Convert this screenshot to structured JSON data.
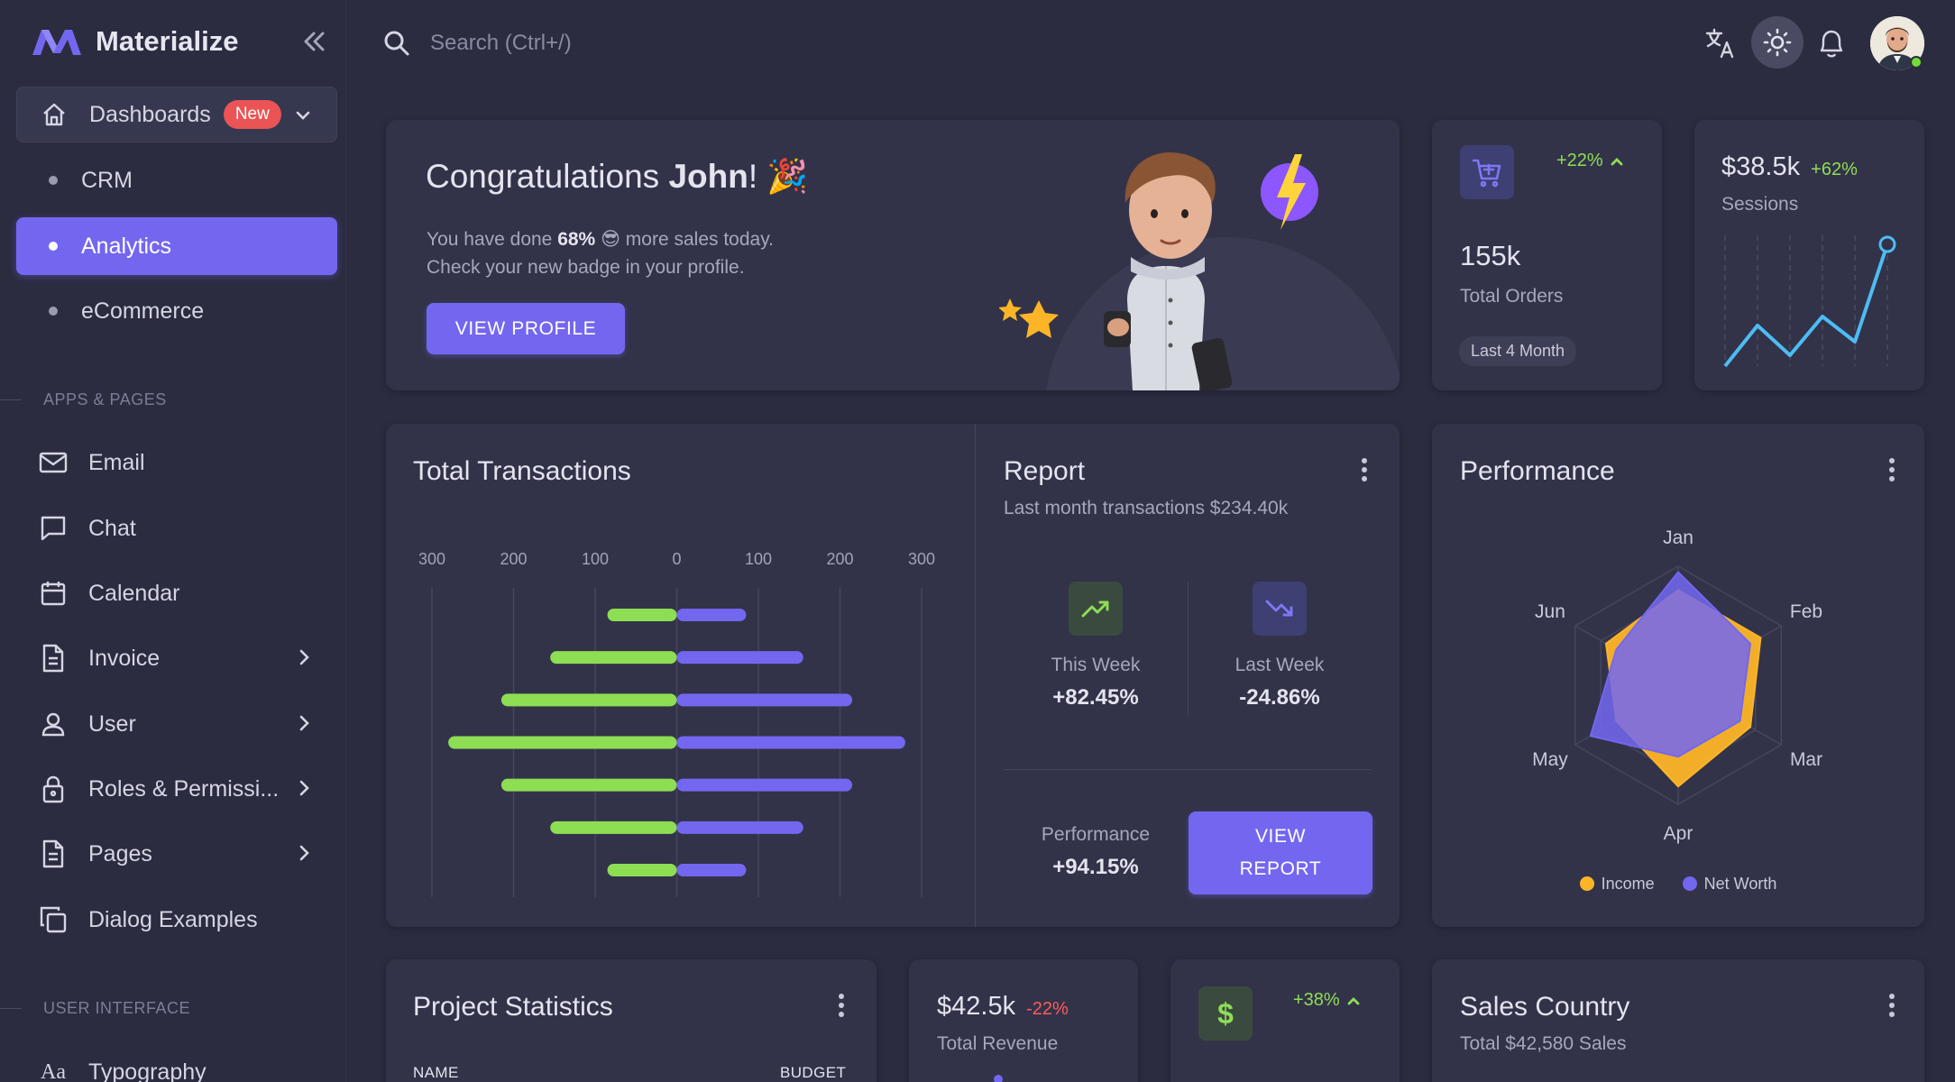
{
  "brand": {
    "name": "Materialize",
    "logo_color": "#7367f0"
  },
  "topbar": {
    "search_placeholder": "Search (Ctrl+/)"
  },
  "sidebar": {
    "dashboards": {
      "label": "Dashboards",
      "badge": "New"
    },
    "dashboard_children": [
      {
        "label": "CRM",
        "active": false
      },
      {
        "label": "Analytics",
        "active": true
      },
      {
        "label": "eCommerce",
        "active": false
      }
    ],
    "section_apps": "APPS & PAGES",
    "apps": [
      {
        "label": "Email",
        "icon": "mail-icon"
      },
      {
        "label": "Chat",
        "icon": "chat-icon"
      },
      {
        "label": "Calendar",
        "icon": "calendar-icon"
      },
      {
        "label": "Invoice",
        "icon": "invoice-icon",
        "has_submenu": true
      },
      {
        "label": "User",
        "icon": "user-icon",
        "has_submenu": true
      },
      {
        "label": "Roles & Permissi...",
        "icon": "lock-icon",
        "has_submenu": true
      },
      {
        "label": "Pages",
        "icon": "page-icon",
        "has_submenu": true
      },
      {
        "label": "Dialog Examples",
        "icon": "copy-icon"
      }
    ],
    "section_ui": "USER INTERFACE",
    "ui": [
      {
        "label": "Typography",
        "icon": "typography-icon"
      }
    ]
  },
  "congrats": {
    "title_prefix": "Congratulations ",
    "name": "John",
    "emoji": "! 🎉",
    "line1_a": "You have done ",
    "line1_pct": "68%",
    "line1_b": " 😎 more sales today.",
    "line2": "Check your new badge in your profile.",
    "button": "VIEW PROFILE"
  },
  "orders": {
    "change": "+22%",
    "value": "155k",
    "label": "Total Orders",
    "chip": "Last 4 Month"
  },
  "sessions": {
    "value": "$38.5k",
    "change": "+62%",
    "label": "Sessions"
  },
  "transactions": {
    "title": "Total Transactions",
    "chart_data": {
      "type": "bar",
      "orientation": "horizontal-diverging",
      "x_ticks": [
        "300",
        "200",
        "100",
        "0",
        "100",
        "200",
        "300"
      ],
      "xlim": [
        -300,
        300
      ],
      "series": [
        {
          "color": "#8ede54",
          "values": [
            -85,
            -155,
            -215,
            -280,
            -215,
            -155,
            -85
          ]
        },
        {
          "color": "#7367f0",
          "values": [
            85,
            155,
            215,
            280,
            215,
            155,
            85
          ]
        }
      ]
    }
  },
  "report": {
    "title": "Report",
    "subtitle": "Last month transactions $234.40k",
    "this_week_label": "This Week",
    "this_week_value": "+82.45%",
    "last_week_label": "Last Week",
    "last_week_value": "-24.86%",
    "performance_label": "Performance",
    "performance_value": "+94.15%",
    "button_line1": "VIEW",
    "button_line2": "REPORT"
  },
  "performance": {
    "title": "Performance",
    "chart_data": {
      "type": "radar",
      "categories": [
        "Jan",
        "Feb",
        "Mar",
        "Apr",
        "May",
        "Jun"
      ],
      "series": [
        {
          "name": "Income",
          "color": "#fdb528",
          "values": [
            80,
            80,
            70,
            85,
            60,
            70
          ]
        },
        {
          "name": "Net Worth",
          "color": "#7367f0",
          "values": [
            95,
            70,
            60,
            60,
            85,
            60
          ]
        }
      ],
      "max": 100
    }
  },
  "project_stats": {
    "title": "Project Statistics",
    "col_name": "NAME",
    "col_budget": "BUDGET"
  },
  "revenue": {
    "value": "$42.5k",
    "change": "-22%",
    "label": "Total Revenue"
  },
  "profit_card": {
    "change": "+38%",
    "icon": "dollar-icon"
  },
  "sales_country": {
    "title": "Sales Country",
    "subtitle": "Total $42,580 Sales"
  }
}
